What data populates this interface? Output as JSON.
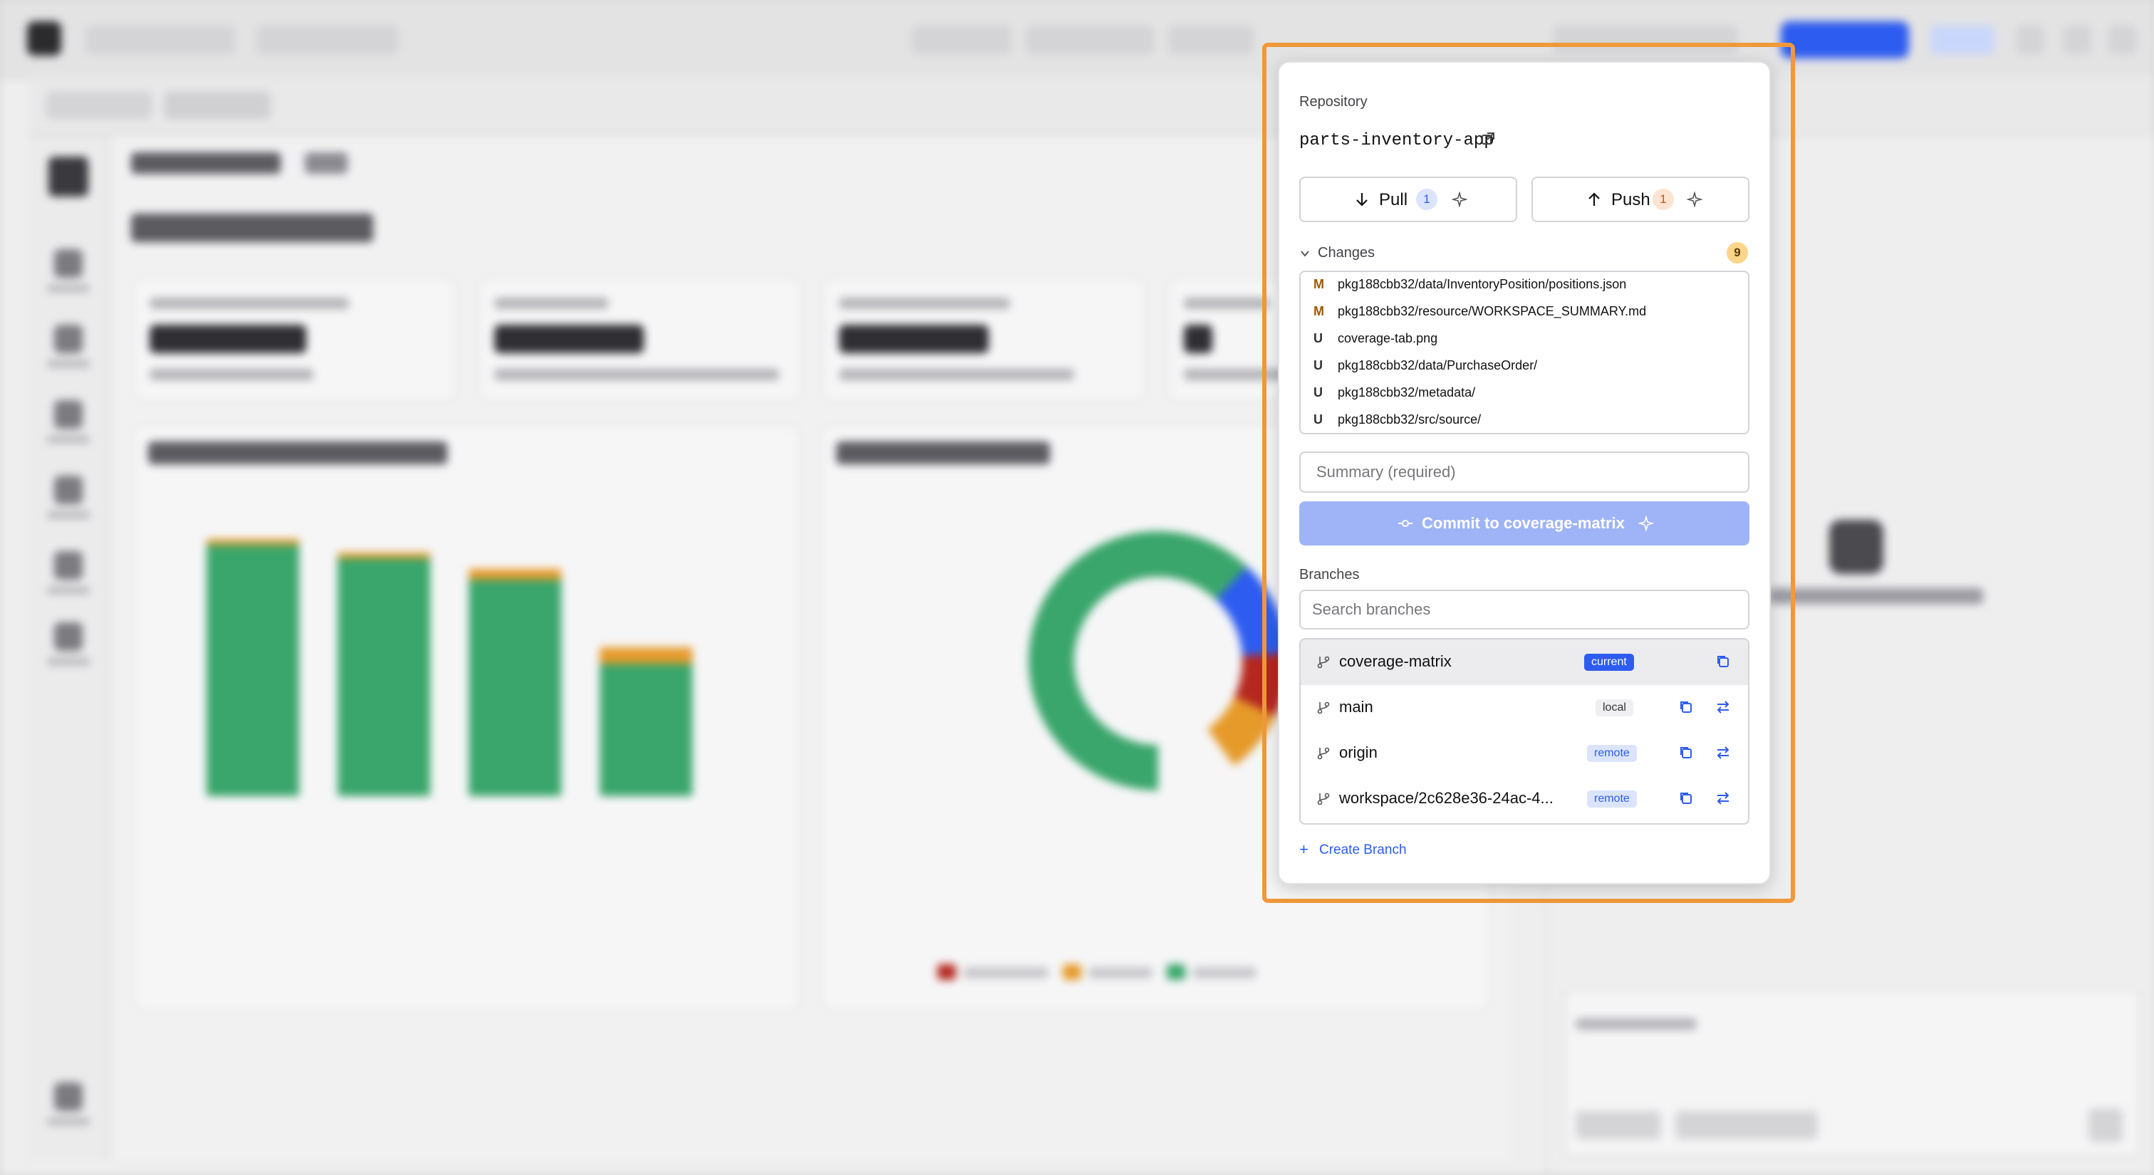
{
  "popover": {
    "repository_label": "Repository",
    "repository_name": "parts-inventory-app",
    "pull": {
      "label": "Pull",
      "count": "1"
    },
    "push": {
      "label": "Push",
      "count": "1"
    },
    "changes": {
      "label": "Changes",
      "count": "9",
      "items": [
        {
          "status": "M",
          "path": "pkg188cbb32/data/InventoryPosition/positions.json"
        },
        {
          "status": "M",
          "path": "pkg188cbb32/resource/WORKSPACE_SUMMARY.md"
        },
        {
          "status": "U",
          "path": "coverage-tab.png"
        },
        {
          "status": "U",
          "path": "pkg188cbb32/data/PurchaseOrder/"
        },
        {
          "status": "U",
          "path": "pkg188cbb32/metadata/"
        },
        {
          "status": "U",
          "path": "pkg188cbb32/src/source/"
        }
      ]
    },
    "summary": {
      "placeholder": "Summary (required)",
      "value": ""
    },
    "commit_label": "Commit to coverage-matrix",
    "branches_label": "Branches",
    "branch_search": {
      "placeholder": "Search branches",
      "value": ""
    },
    "branches": [
      {
        "name": "coverage-matrix",
        "tag": "current",
        "selected": true
      },
      {
        "name": "main",
        "tag": "local",
        "selected": false
      },
      {
        "name": "origin",
        "tag": "remote",
        "selected": false
      },
      {
        "name": "workspace/2c628e36-24ac-4...",
        "tag": "remote",
        "selected": false
      }
    ],
    "create_branch_label": "Create Branch"
  },
  "colors": {
    "accent": "#2d5cf0",
    "highlight": "#f0993a",
    "modified": "#9a5a00",
    "commit_disabled": "#9fb4f6",
    "tag_current_bg": "#2d5cf0",
    "tag_remote_bg": "#dbe4fd"
  },
  "background": {
    "bars": [
      {
        "green": 0.93,
        "orange": 0.02
      },
      {
        "green": 0.88,
        "orange": 0.02
      },
      {
        "green": 0.8,
        "orange": 0.04
      },
      {
        "green": 0.49,
        "orange": 0.06
      }
    ],
    "donut": [
      {
        "color": "#3aa66b",
        "fraction": 0.62
      },
      {
        "color": "#2d5cf0",
        "fraction": 0.12
      },
      {
        "color": "#b5281f",
        "fraction": 0.08
      },
      {
        "color": "#e69a2a",
        "fraction": 0.08
      }
    ]
  }
}
